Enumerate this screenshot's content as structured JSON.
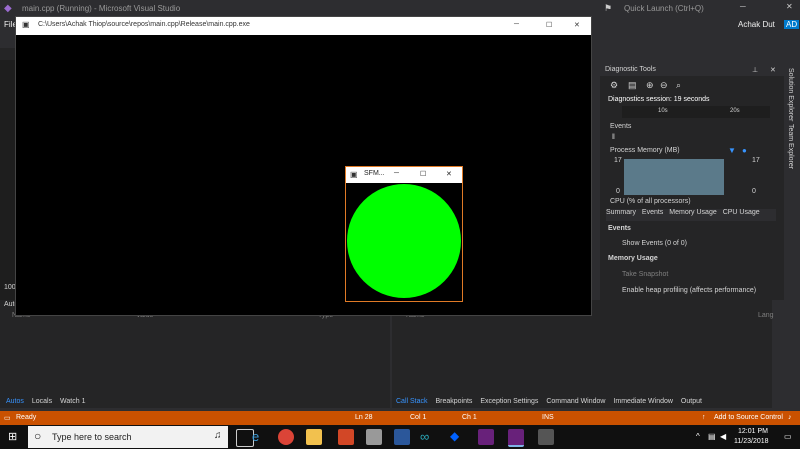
{
  "vs": {
    "title": "main.cpp (Running) - Microsoft Visual Studio",
    "quick_launch": "Quick Launch (Ctrl+Q)",
    "user": "Achak Dut",
    "user_initials": "AD",
    "menu_file": "File"
  },
  "console": {
    "title": "C:\\Users\\Achak Thiop\\source\\repos\\main.cpp\\Release\\main.cpp.exe"
  },
  "sfml": {
    "title": "SFM...",
    "circle_color": "#00ff00"
  },
  "diag": {
    "title": "Diagnostic Tools",
    "session": "Diagnostics session: 19 seconds",
    "t10": "10s",
    "t20": "20s",
    "events": "Events",
    "process_memory": "Process Memory (MB)",
    "mem_max_left": "17",
    "mem_max_right": "17",
    "mem_min_left": "0",
    "mem_min_right": "0",
    "cpu": "CPU (% of all processors)",
    "tabs": [
      "Summary",
      "Events",
      "Memory Usage",
      "CPU Usage"
    ],
    "events_section": "Events",
    "show_events": "Show Events (0 of 0)",
    "memory_usage": "Memory Usage",
    "take_snapshot": "Take Snapshot",
    "heap_profiling": "Enable heap profiling (affects performance)"
  },
  "right_rail": {
    "solution_explorer": "Solution Explorer",
    "team_explorer": "Team Explorer"
  },
  "left": {
    "autos": "Autos",
    "col_name": "Name",
    "col_value": "Value",
    "col_type": "Type",
    "tabs": [
      "Autos",
      "Locals",
      "Watch 1"
    ],
    "zoom": "100 %"
  },
  "right_bottom": {
    "col_name": "Name",
    "col_lang": "Lang",
    "tabs": [
      "Call Stack",
      "Breakpoints",
      "Exception Settings",
      "Command Window",
      "Immediate Window",
      "Output"
    ]
  },
  "status": {
    "ready": "Ready",
    "ln": "Ln 28",
    "col": "Col 1",
    "ch": "Ch 1",
    "ins": "INS",
    "source_control": "Add to Source Control"
  },
  "taskbar": {
    "search_placeholder": "Type here to search",
    "time": "12:01 PM",
    "date": "11/23/2018"
  }
}
